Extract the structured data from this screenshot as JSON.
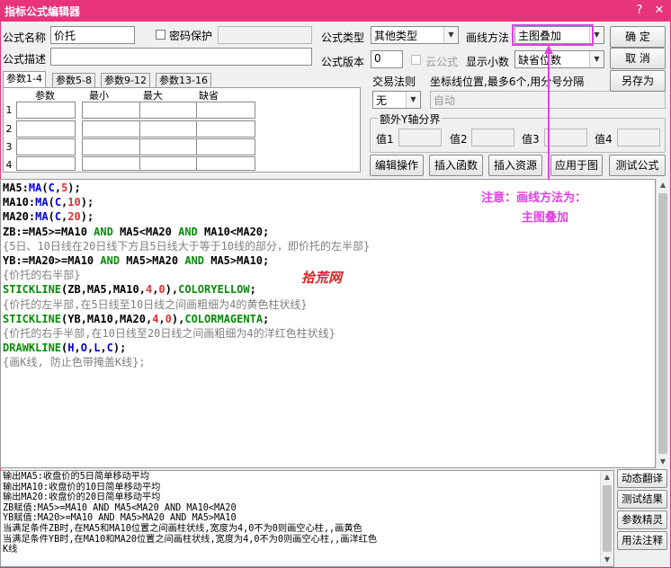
{
  "window": {
    "title": "指标公式编辑器",
    "help_glyph": "?",
    "close_glyph": "✕"
  },
  "form": {
    "name_label": "公式名称",
    "name_value": "价托",
    "password_label": "密码保护",
    "desc_label": "公式描述",
    "desc_value": "",
    "type_label": "公式类型",
    "type_value": "其他类型",
    "draw_label": "画线方法",
    "draw_value": "主图叠加",
    "version_label": "公式版本",
    "version_value": "0",
    "cloud_label": "云公式",
    "decimals_label": "显示小数",
    "decimals_value": "缺省位数",
    "trade_label": "交易法则",
    "trade_value": "无",
    "coord_label": "坐标线位置,最多6个,用分号分隔",
    "coord_value": "自动",
    "yaxis_label": "额外Y轴分界",
    "yaxis_values": [
      "值1",
      "值2",
      "值3",
      "值4"
    ]
  },
  "buttons": {
    "ok": "确  定",
    "cancel": "取  消",
    "save_as": "另存为",
    "edit": "编辑操作",
    "insert_fn": "插入函数",
    "insert_res": "插入资源",
    "apply": "应用于图",
    "test": "测试公式"
  },
  "params": {
    "tabs": [
      "参数1-4",
      "参数5-8",
      "参数9-12",
      "参数13-16"
    ],
    "headers": [
      "参数",
      "最小",
      "最大",
      "缺省"
    ],
    "rows": [
      "1",
      "2",
      "3",
      "4"
    ]
  },
  "code_lines": [
    [
      [
        "MA5:",
        ""
      ],
      [
        "MA",
        "kw"
      ],
      [
        "(",
        ""
      ],
      [
        "C",
        "kw"
      ],
      [
        ",",
        ""
      ],
      [
        "5",
        "num"
      ],
      [
        ");",
        ""
      ]
    ],
    [
      [
        "MA10:",
        ""
      ],
      [
        "MA",
        "kw"
      ],
      [
        "(",
        ""
      ],
      [
        "C",
        "kw"
      ],
      [
        ",",
        ""
      ],
      [
        "10",
        "num"
      ],
      [
        ");",
        ""
      ]
    ],
    [
      [
        "MA20:",
        ""
      ],
      [
        "MA",
        "kw"
      ],
      [
        "(",
        ""
      ],
      [
        "C",
        "kw"
      ],
      [
        ",",
        ""
      ],
      [
        "20",
        "num"
      ],
      [
        ");",
        ""
      ]
    ],
    [
      [
        "ZB:=MA5>=MA10 ",
        ""
      ],
      [
        "AND",
        "fn"
      ],
      [
        " MA5<MA20 ",
        ""
      ],
      [
        "AND",
        "fn"
      ],
      [
        " MA10<MA20;",
        ""
      ]
    ],
    [
      [
        "{5日、10日线在20日线下方且5日线大于等于10线的部分，即价托的左半部}",
        "cmt"
      ]
    ],
    [
      [
        "YB:=MA20>=MA10 ",
        ""
      ],
      [
        "AND",
        "fn"
      ],
      [
        " MA5>MA20 ",
        ""
      ],
      [
        "AND",
        "fn"
      ],
      [
        " MA5>MA10;",
        ""
      ]
    ],
    [
      [
        "{价托的右半部}",
        "cmt"
      ]
    ],
    [
      [
        "STICKLINE",
        "fn"
      ],
      [
        "(ZB,MA5,MA10,",
        ""
      ],
      [
        "4",
        "num"
      ],
      [
        ",",
        ""
      ],
      [
        "0",
        "num"
      ],
      [
        "),",
        ""
      ],
      [
        "COLORYELLOW",
        "fn"
      ],
      [
        ";",
        ""
      ]
    ],
    [
      [
        "{价托的左半部,在5日线至10日线之间画粗细为4的黄色柱状线}",
        "cmt"
      ]
    ],
    [
      [
        "STICKLINE",
        "fn"
      ],
      [
        "(YB,MA10,MA20,",
        ""
      ],
      [
        "4",
        "num"
      ],
      [
        ",",
        ""
      ],
      [
        "0",
        "num"
      ],
      [
        "),",
        ""
      ],
      [
        "COLORMAGENTA",
        "fn"
      ],
      [
        ";",
        ""
      ]
    ],
    [
      [
        "{价托的右手半部,在10日线至20日线之间画粗细为4的洋红色柱状线}",
        "cmt"
      ]
    ],
    [
      [
        "DRAWKLINE",
        "fn"
      ],
      [
        "(",
        ""
      ],
      [
        "H",
        "kw"
      ],
      [
        ",",
        ""
      ],
      [
        "O",
        "kw"
      ],
      [
        ",",
        ""
      ],
      [
        "L",
        "kw"
      ],
      [
        ",",
        ""
      ],
      [
        "C",
        "kw"
      ],
      [
        ");",
        ""
      ]
    ],
    [
      [
        "{画K线, 防止色带掩盖K线};",
        "cmt"
      ]
    ]
  ],
  "watermark": "拾荒网",
  "annotation": {
    "line1": "注意：画线方法为：",
    "line2": "主图叠加"
  },
  "output": {
    "lines": [
      "输出MA5:收盘价的5日简单移动平均",
      "输出MA10:收盘价的10日简单移动平均",
      "输出MA20:收盘价的20日简单移动平均",
      "ZB赋值:MA5>=MA10 AND MA5<MA20 AND MA10<MA20",
      "YB赋值:MA20>=MA10 AND MA5>MA20 AND MA5>MA10",
      "当满足条件ZB时,在MA5和MA10位置之间画柱状线,宽度为4,0不为0则画空心柱,,画黄色",
      "当满足条件YB时,在MA10和MA20位置之间画柱状线,宽度为4,0不为0则画空心柱,,画洋红色",
      "K线"
    ],
    "side_buttons": [
      "动态翻译",
      "测试结果",
      "参数精灵",
      "用法注释"
    ]
  },
  "colors": {
    "titlebar": "#e8347a",
    "annotation": "#e040e0"
  }
}
